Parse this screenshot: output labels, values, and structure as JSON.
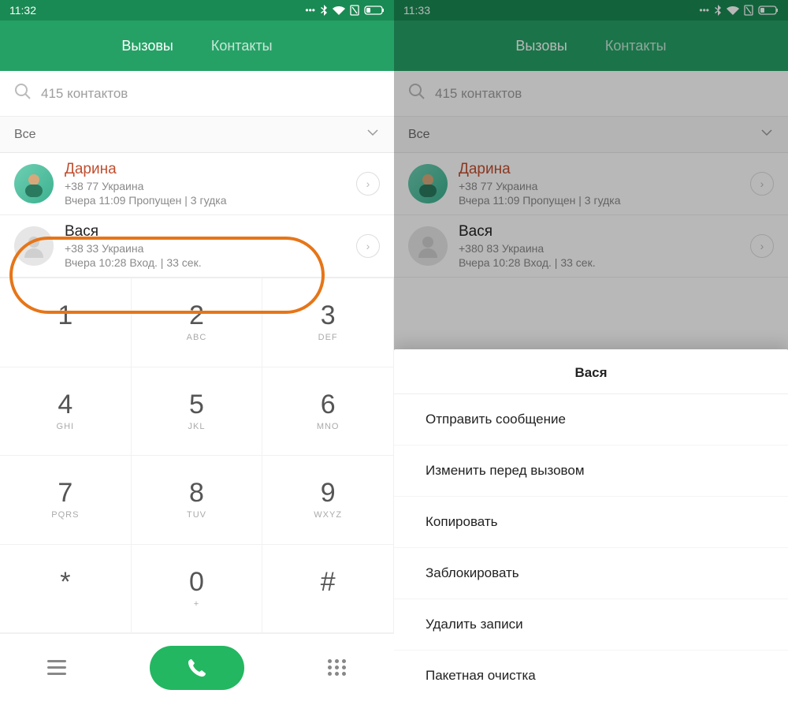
{
  "left": {
    "status_time": "11:32",
    "tabs": {
      "calls": "Вызовы",
      "contacts": "Контакты"
    },
    "search_placeholder": "415 контактов",
    "filter_label": "Все",
    "calls": [
      {
        "name": "Дарина",
        "missed": true,
        "phone": "+38            77  Украина",
        "meta": "Вчера 11:09 Пропущен | 3 гудка"
      },
      {
        "name": "Вася",
        "missed": false,
        "phone": "+38            33  Украина",
        "meta": "Вчера 10:28 Вход. | 33 сек."
      }
    ],
    "dialpad": [
      {
        "d": "1",
        "l": ""
      },
      {
        "d": "2",
        "l": "ABC"
      },
      {
        "d": "3",
        "l": "DEF"
      },
      {
        "d": "4",
        "l": "GHI"
      },
      {
        "d": "5",
        "l": "JKL"
      },
      {
        "d": "6",
        "l": "MNO"
      },
      {
        "d": "7",
        "l": "PQRS"
      },
      {
        "d": "8",
        "l": "TUV"
      },
      {
        "d": "9",
        "l": "WXYZ"
      },
      {
        "d": "*",
        "l": ""
      },
      {
        "d": "0",
        "l": "+"
      },
      {
        "d": "#",
        "l": ""
      }
    ]
  },
  "right": {
    "status_time": "11:33",
    "tabs": {
      "calls": "Вызовы",
      "contacts": "Контакты"
    },
    "search_placeholder": "415 контактов",
    "filter_label": "Все",
    "calls": [
      {
        "name": "Дарина",
        "missed": true,
        "phone": "+38            77  Украина",
        "meta": "Вчера 11:09 Пропущен | 3 гудка"
      },
      {
        "name": "Вася",
        "missed": false,
        "phone": "+380           83  Украина",
        "meta": "Вчера 10:28 Вход. | 33 сек."
      }
    ],
    "sheet": {
      "title": "Вася",
      "items": [
        "Отправить сообщение",
        "Изменить перед вызовом",
        "Копировать",
        "Заблокировать",
        "Удалить записи",
        "Пакетная очистка"
      ]
    }
  }
}
